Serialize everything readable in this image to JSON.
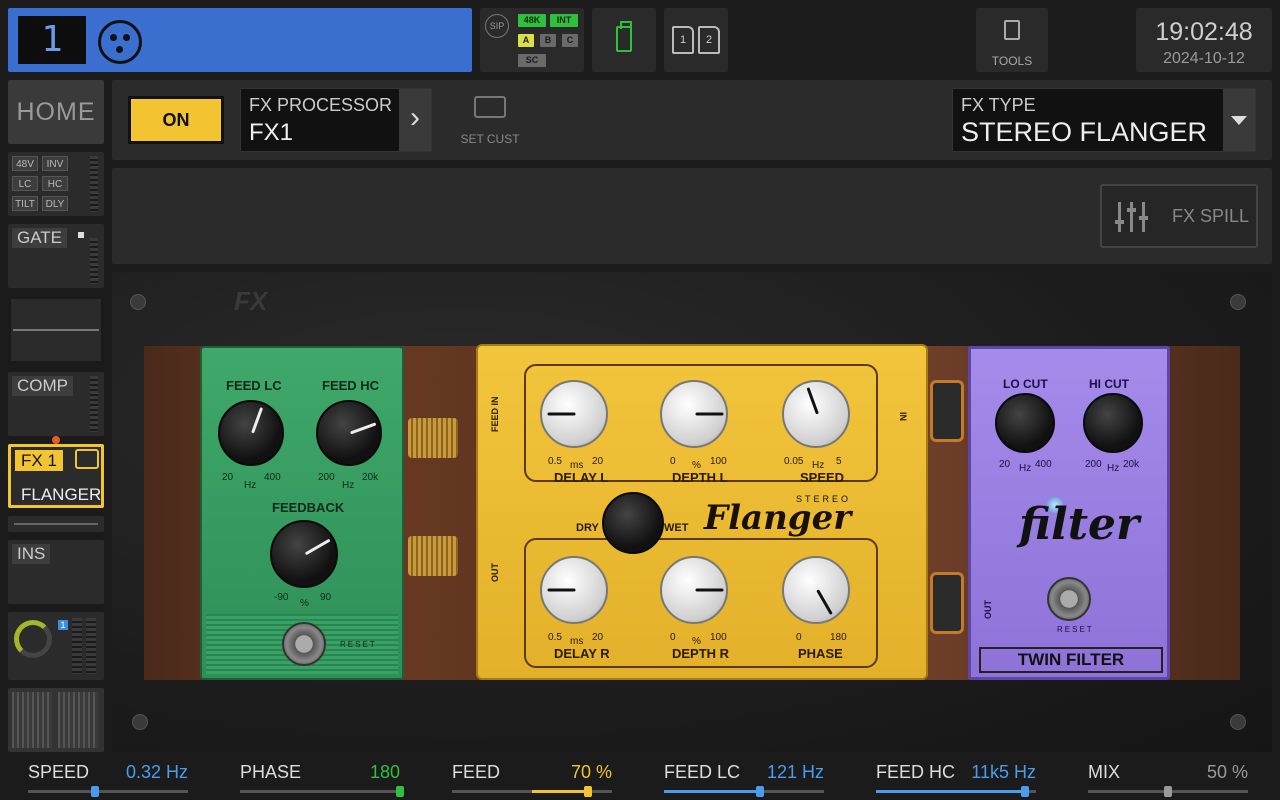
{
  "channel": {
    "number": "1",
    "icon": "xlr-icon"
  },
  "status": {
    "sip": "SIP",
    "rate": "48K",
    "clock": "INT",
    "slots": [
      "A",
      "B",
      "C"
    ],
    "sc": "SC"
  },
  "cards": [
    "1",
    "2"
  ],
  "tools": {
    "label": "TOOLS"
  },
  "clock": {
    "time": "19:02:48",
    "date": "2024-10-12"
  },
  "sidebar": {
    "home": "HOME",
    "preamp_tags": [
      "48V",
      "INV",
      "LC",
      "HC",
      "TILT",
      "DLY"
    ],
    "gate": "GATE",
    "comp": "COMP",
    "fx_slot": "FX 1",
    "fx_name": "FLANGER",
    "ins": "INS",
    "bus_badge": "1"
  },
  "header": {
    "on_label": "ON",
    "fx_processor_label": "FX PROCESSOR",
    "fx_processor_value": "FX1",
    "set_cust_label": "SET CUST",
    "fx_type_label": "FX TYPE",
    "fx_type_value": "STEREO FLANGER"
  },
  "spill": {
    "label": "FX SPILL"
  },
  "pedals": {
    "green": {
      "feed_lc": "FEED LC",
      "feed_lc_min": "20",
      "feed_lc_unit": "Hz",
      "feed_lc_max": "400",
      "feed_hc": "FEED HC",
      "feed_hc_min": "200",
      "feed_hc_unit": "Hz",
      "feed_hc_max": "20k",
      "feedback": "FEEDBACK",
      "feedback_min": "-90",
      "feedback_unit": "%",
      "feedback_max": "90",
      "reset": "RESET"
    },
    "yellow": {
      "feed_in": "FEED IN",
      "out": "OUT",
      "in": "IN",
      "delay_l": "DELAY L",
      "delay_l_min": "0.5",
      "delay_l_unit": "ms",
      "delay_l_max": "20",
      "depth_l": "DEPTH L",
      "depth_l_min": "0",
      "depth_l_unit": "%",
      "depth_l_max": "100",
      "speed": "SPEED",
      "speed_min": "0.05",
      "speed_unit": "Hz",
      "speed_max": "5",
      "dry": "DRY",
      "wet": "WET",
      "brand": "Flanger",
      "brand_sub": "STEREO",
      "delay_r": "DELAY R",
      "delay_r_min": "0.5",
      "delay_r_unit": "ms",
      "delay_r_max": "20",
      "depth_r": "DEPTH R",
      "depth_r_min": "0",
      "depth_r_unit": "%",
      "depth_r_max": "100",
      "phase": "PHASE",
      "phase_min": "0",
      "phase_max": "180"
    },
    "purple": {
      "lo_cut": "LO CUT",
      "lo_cut_min": "20",
      "lo_cut_unit": "Hz",
      "lo_cut_max": "400",
      "hi_cut": "HI CUT",
      "hi_cut_min": "200",
      "hi_cut_unit": "Hz",
      "hi_cut_max": "20k",
      "brand": "filter",
      "reset": "RESET",
      "out": "OUT",
      "name": "TWIN FILTER"
    }
  },
  "params": [
    {
      "name": "SPEED",
      "value": "0.32 Hz",
      "color": "#4a9cf0",
      "level": 0.42
    },
    {
      "name": "PHASE",
      "value": "180",
      "color": "#2ec13b",
      "level": 1.0
    },
    {
      "name": "FEED",
      "value": "70 %",
      "color": "#f3c431",
      "level": 0.85
    },
    {
      "name": "FEED LC",
      "value": "121 Hz",
      "color": "#4a9cf0",
      "level": 0.6
    },
    {
      "name": "FEED HC",
      "value": "11k5 Hz",
      "color": "#4a9cf0",
      "level": 0.93
    },
    {
      "name": "MIX",
      "value": "50 %",
      "color": "#9a9a9a",
      "level": 0.5
    }
  ],
  "colors": {
    "accent": "#f3c431",
    "channel": "#3a6fd0",
    "active": "#2ec13b"
  }
}
